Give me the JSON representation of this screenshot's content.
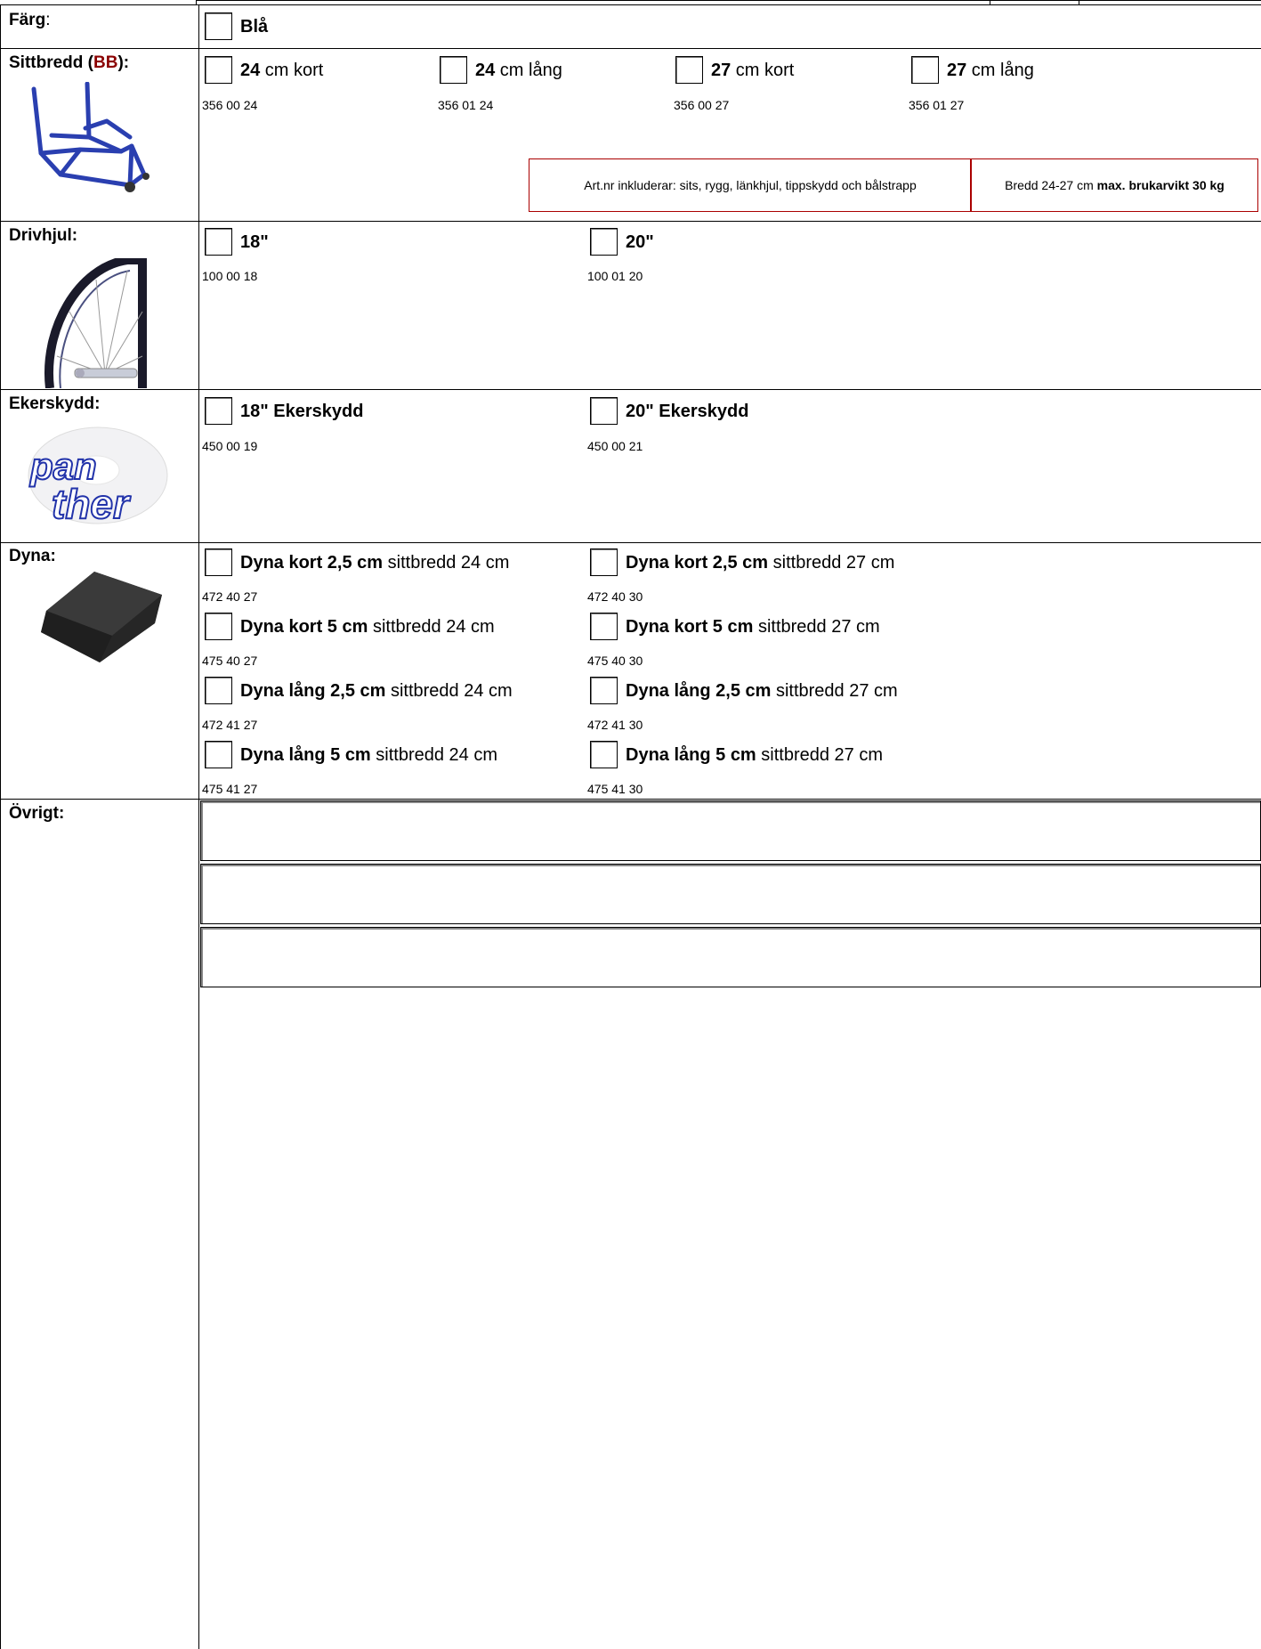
{
  "rows": {
    "farg": {
      "label": "Färg",
      "label_suffix": ":",
      "options": [
        {
          "bold": "Blå",
          "text": ""
        }
      ]
    },
    "sittbredd": {
      "label_pre": "Sittbredd (",
      "label_red": "BB",
      "label_post": "):",
      "options": [
        {
          "bold": "24",
          "text": " cm kort",
          "code": "356 00 24"
        },
        {
          "bold": "24",
          "text": " cm lång",
          "code": "356 01 24"
        },
        {
          "bold": "27",
          "text": " cm kort",
          "code": "356 00 27"
        },
        {
          "bold": "27",
          "text": " cm lång",
          "code": "356 01 27"
        }
      ],
      "note_1": "Art.nr inkluderar: sits, rygg, länkhjul, tippskydd och bålstrapp",
      "note_2_normal": "Bredd 24-27 cm ",
      "note_2_bold": "max. brukarvikt 30 kg"
    },
    "drivhjul": {
      "label": "Drivhjul:",
      "options": [
        {
          "bold": "18\"",
          "text": "",
          "code": "100 00 18"
        },
        {
          "bold": "20\"",
          "text": "",
          "code": "100 01 20"
        }
      ]
    },
    "ekerskydd": {
      "label": "Ekerskydd:",
      "options": [
        {
          "bold": "18\" Ekerskydd",
          "text": "",
          "code": "450 00 19"
        },
        {
          "bold": "20\" Ekerskydd",
          "text": "",
          "code": "450 00 21"
        }
      ]
    },
    "dyna": {
      "label": "Dyna:",
      "options": [
        {
          "bold": "Dyna kort 2,5 cm",
          "text": " sittbredd 24 cm",
          "code": "472 40 27"
        },
        {
          "bold": "Dyna kort 2,5 cm",
          "text": " sittbredd 27 cm",
          "code": "472 40 30"
        },
        {
          "bold": "Dyna kort 5 cm",
          "text": " sittbredd 24 cm",
          "code": "475 40 27"
        },
        {
          "bold": "Dyna kort 5 cm",
          "text": " sittbredd 27 cm",
          "code": "475 40 30"
        },
        {
          "bold": "Dyna lång 2,5 cm",
          "text": " sittbredd 24 cm",
          "code": "472 41 27"
        },
        {
          "bold": "Dyna lång 2,5 cm",
          "text": " sittbredd 27 cm",
          "code": "472 41 30"
        },
        {
          "bold": "Dyna lång 5 cm",
          "text": " sittbredd 24 cm",
          "code": "475 41 27"
        },
        {
          "bold": "Dyna lång 5 cm",
          "text": " sittbredd 27 cm",
          "code": "475 41 30"
        }
      ]
    },
    "ovrigt": {
      "label": "Övrigt:",
      "fields": [
        "",
        "",
        ""
      ]
    }
  },
  "images": {
    "ekerskydd_logo_text_1": "pan",
    "ekerskydd_logo_text_2": "ther"
  },
  "colors": {
    "frame_blue": "#2a3fb0",
    "note_border": "#aa0000",
    "label_red": "#8b0000"
  }
}
